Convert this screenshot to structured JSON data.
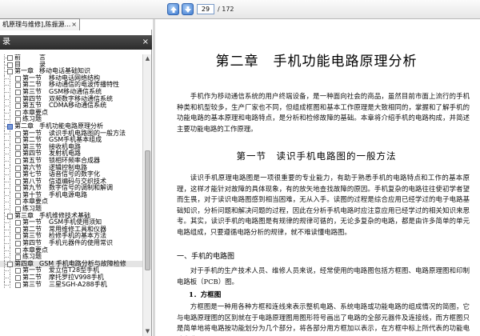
{
  "toolbar": {
    "doc_tab_label": "机原理与维修],陈振源...",
    "doc_tab_close": "×",
    "current_page": "29",
    "total_pages": "/ 172"
  },
  "left_panel": {
    "header": "录",
    "close": "×"
  },
  "toc": [
    {
      "lvl": 1,
      "num": "前",
      "title": "言"
    },
    {
      "lvl": 1,
      "num": "目",
      "title": "录"
    },
    {
      "lvl": 1,
      "num": "第一章",
      "title": "移动电话基础知识"
    },
    {
      "lvl": 2,
      "num": "第一节",
      "title": "移动电话网络结构"
    },
    {
      "lvl": 2,
      "num": "第二节",
      "title": "移动通信的电波传播特性"
    },
    {
      "lvl": 2,
      "num": "第三节",
      "title": "GSM移动通信系统"
    },
    {
      "lvl": 2,
      "num": "第四节",
      "title": "双频数字移动通信系统"
    },
    {
      "lvl": 2,
      "num": "第五节",
      "title": "CDMA移动通信系统"
    },
    {
      "lvl": 2,
      "num": "本章要点",
      "title": ""
    },
    {
      "lvl": 2,
      "num": "练习题",
      "title": ""
    },
    {
      "lvl": 1,
      "num": "第二章",
      "title": "手机功能电路原理分析",
      "sel": true
    },
    {
      "lvl": 2,
      "num": "第一节",
      "title": "读识手机电路图的一般方法"
    },
    {
      "lvl": 2,
      "num": "第二节",
      "title": "GSM手机基本组成"
    },
    {
      "lvl": 2,
      "num": "第三节",
      "title": "接收机电路"
    },
    {
      "lvl": 2,
      "num": "第四节",
      "title": "发射机电路"
    },
    {
      "lvl": 2,
      "num": "第五节",
      "title": "锁相环频率合成器"
    },
    {
      "lvl": 2,
      "num": "第六节",
      "title": "逻辑控制电路"
    },
    {
      "lvl": 2,
      "num": "第七节",
      "title": "语音信号的数字化"
    },
    {
      "lvl": 2,
      "num": "第八节",
      "title": "信道编码与交织技术"
    },
    {
      "lvl": 2,
      "num": "第九节",
      "title": "数字信号的调制和解调"
    },
    {
      "lvl": 2,
      "num": "第十节",
      "title": "手机电源电路"
    },
    {
      "lvl": 2,
      "num": "本章要点",
      "title": ""
    },
    {
      "lvl": 2,
      "num": "练习题",
      "title": ""
    },
    {
      "lvl": 1,
      "num": "第三章",
      "title": "手机维修技术基础"
    },
    {
      "lvl": 2,
      "num": "第一节",
      "title": "GSM手机使用须知"
    },
    {
      "lvl": 2,
      "num": "第二节",
      "title": "常用维修工具和仪器"
    },
    {
      "lvl": 2,
      "num": "第三节",
      "title": "检修手机的基本方法"
    },
    {
      "lvl": 2,
      "num": "第四节",
      "title": "手机元器件的使用常识"
    },
    {
      "lvl": 2,
      "num": "本章要点",
      "title": ""
    },
    {
      "lvl": 2,
      "num": "练习题",
      "title": ""
    },
    {
      "lvl": 1,
      "num": "第四章",
      "title": "GSM 手机电路分析与故障检修",
      "hl": true
    },
    {
      "lvl": 2,
      "num": "第一节",
      "title": "爱立信T28型手机"
    },
    {
      "lvl": 2,
      "num": "第二节",
      "title": "摩托罗拉V998手机"
    },
    {
      "lvl": 2,
      "num": "第三节",
      "title": "三星SGH-A288手机"
    }
  ],
  "document": {
    "chapter_title": "第二章　手机功能电路原理分析",
    "intro": "手机作为移动通信系统的用户终端设备，是一种面向社会的商品，虽然目前市面上流行的手机种类和机型较多，生产厂家也不同，但组成框图和基本工作原理是大致相同的，掌握和了解手机的功能电路的基本原理和电路特点，是分析和检修故障的基础。本章将介绍手机的电路构成，并简述主要功能电路的工作原理。",
    "section_title": "第一节　读识手机电路图的一般方法",
    "section_para": "读识手机原理电路图是一项很重要的专业能力，有助于熟悉手机的电路特点和工作的基本原理，这样才能针对故障的具体现象，有的放矢地查找故障的原因。手机复杂的电路往往使初学者望而生畏，对于读识电路图感到相当困难，无从入手。读图的过程是综合应用已经学过的电子电路基础知识，分析问题和解决问题的过程，因此在分析手机电路时应注意应用已经学过的相关知识来思考。其实，读识手机的电路图是有规律的规律可循的，无论多复杂的电路，都是由许多简单的单元电路组成，只要遵循电路分析的规律，就不难读懂电路图。",
    "sub_title": "一、手机的电路图",
    "sub_para": "对于手机的生产技术人员、维修人员来说，经常使用的电路图包括方框图、电路原理图和印制电路板（PCB）图。",
    "item_title": "1．方框图",
    "item_para": "方框图是一种用各种方框和连线来表示整机电路、系统电路或功能电路的组成情况的简图，它与电路原理图的区别就在于电路原理图用图形符号画出了电路的全部元器件及连接线，而方框图只是简单地将电路按功能划分为几个部分，将各部分用方框加以表示，在方框中标上所代表的功能电路名称。"
  }
}
